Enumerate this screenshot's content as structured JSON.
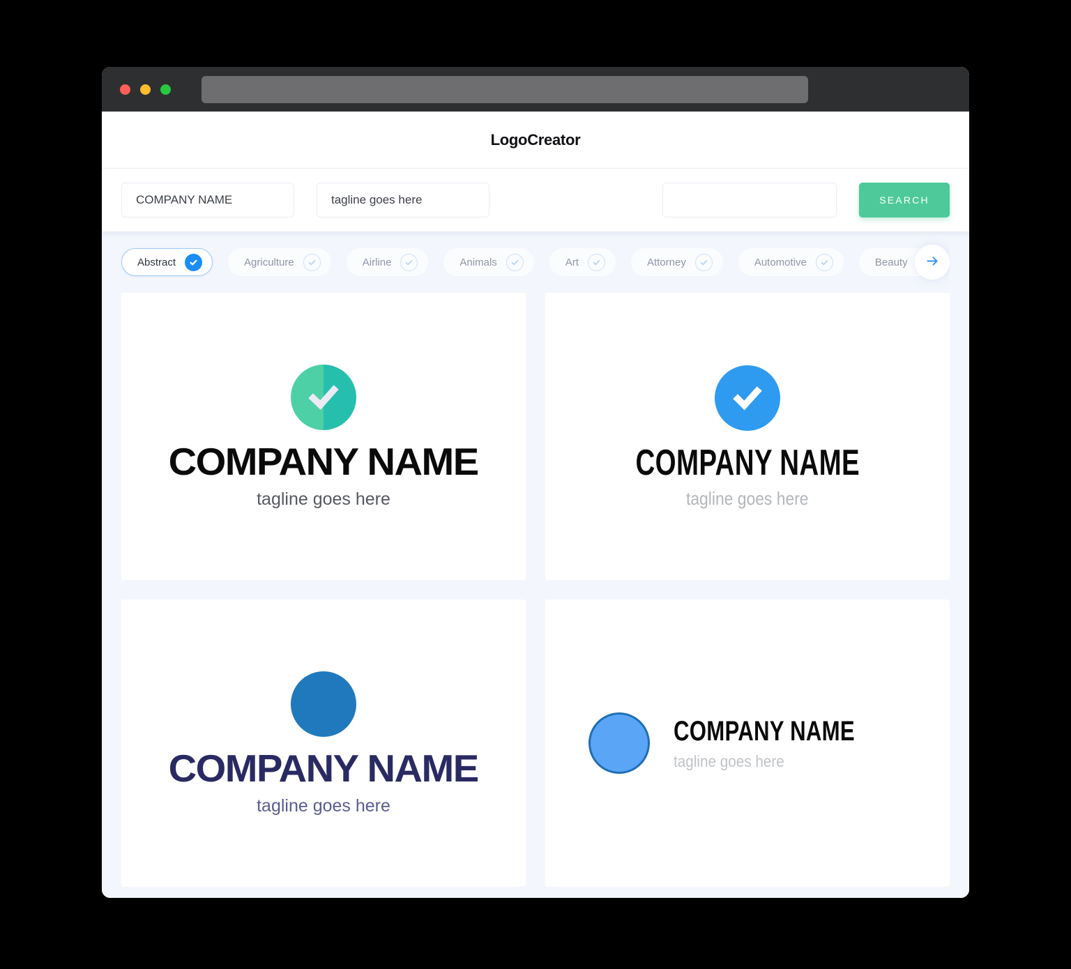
{
  "window": {
    "traffic_lights": [
      "close",
      "minimize",
      "maximize"
    ],
    "url_value": ""
  },
  "header": {
    "title": "LogoCreator"
  },
  "search": {
    "company_name_value": "COMPANY NAME",
    "company_name_placeholder": "COMPANY NAME",
    "tagline_value": "tagline goes here",
    "tagline_placeholder": "tagline goes here",
    "extra_value": "",
    "extra_placeholder": "",
    "search_label": "SEARCH",
    "search_color": "#4ec99a"
  },
  "categories": {
    "next_arrow_icon": "arrow-right-icon",
    "items": [
      {
        "label": "Abstract",
        "selected": true
      },
      {
        "label": "Agriculture",
        "selected": false
      },
      {
        "label": "Airline",
        "selected": false
      },
      {
        "label": "Animals",
        "selected": false
      },
      {
        "label": "Art",
        "selected": false
      },
      {
        "label": "Attorney",
        "selected": false
      },
      {
        "label": "Automotive",
        "selected": false
      },
      {
        "label": "Beauty",
        "selected": false
      }
    ],
    "selected_accent": "#1b8ef5"
  },
  "logos": [
    {
      "id": "logo-card-1",
      "icon": "check-circle-split-icon",
      "name": "COMPANY NAME",
      "tagline": "tagline goes here",
      "mark_colors": [
        "#4dd0a6",
        "#26bfae"
      ],
      "name_color": "#0a0a0a",
      "tagline_color": "#55585f",
      "layout": "stacked"
    },
    {
      "id": "logo-card-2",
      "icon": "check-circle-icon",
      "name": "COMPANY NAME",
      "tagline": "tagline goes here",
      "mark_colors": [
        "#2e9bf0"
      ],
      "name_color": "#0a0a0a",
      "tagline_color": "#b3b6bb",
      "layout": "stacked"
    },
    {
      "id": "logo-card-3",
      "icon": "circle-icon",
      "name": "COMPANY NAME",
      "tagline": "tagline goes here",
      "mark_colors": [
        "#2079bd"
      ],
      "name_color": "#2a2a63",
      "tagline_color": "#5c5c91",
      "layout": "stacked"
    },
    {
      "id": "logo-card-4",
      "icon": "circle-outline-icon",
      "name": "COMPANY NAME",
      "tagline": "tagline goes here",
      "mark_colors": [
        "#5ba5f7",
        "#1e6fb5"
      ],
      "name_color": "#0a0a0a",
      "tagline_color": "#c0c3c8",
      "layout": "horizontal"
    }
  ]
}
